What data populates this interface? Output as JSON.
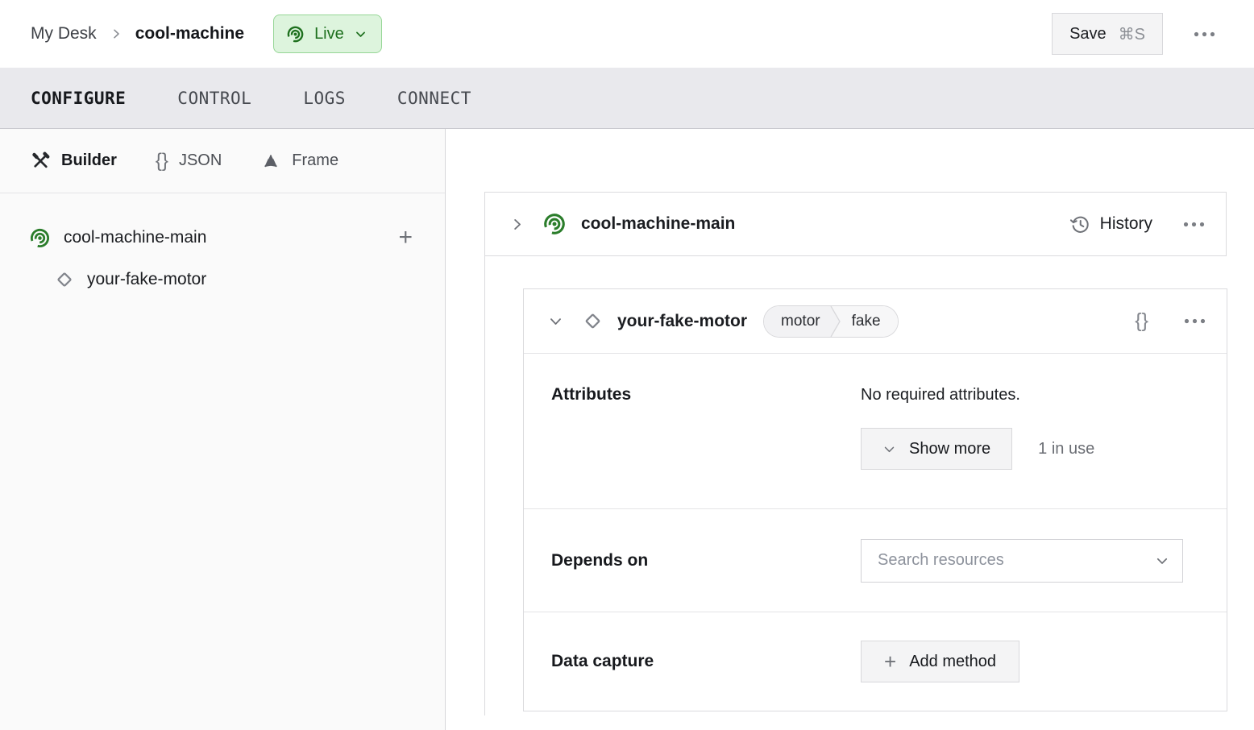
{
  "header": {
    "breadcrumb": {
      "root": "My Desk",
      "current": "cool-machine"
    },
    "live_badge": {
      "label": "Live"
    },
    "save_button": {
      "label": "Save",
      "shortcut": "⌘S"
    }
  },
  "nav_tabs": [
    {
      "label": "CONFIGURE"
    },
    {
      "label": "CONTROL"
    },
    {
      "label": "LOGS"
    },
    {
      "label": "CONNECT"
    }
  ],
  "sidebar": {
    "modes": [
      {
        "label": "Builder"
      },
      {
        "label": "JSON"
      },
      {
        "label": "Frame"
      }
    ],
    "tree": {
      "root_label": "cool-machine-main",
      "child_label": "your-fake-motor"
    }
  },
  "main": {
    "machine_card": {
      "title": "cool-machine-main",
      "history_label": "History"
    },
    "component_card": {
      "title": "your-fake-motor",
      "type_badge": {
        "type": "motor",
        "model": "fake"
      },
      "attributes": {
        "label": "Attributes",
        "empty_text": "No required attributes.",
        "show_more_label": "Show more",
        "usage_text": "1 in use"
      },
      "depends_on": {
        "label": "Depends on",
        "placeholder": "Search resources"
      },
      "data_capture": {
        "label": "Data capture",
        "add_button_label": "Add method"
      }
    }
  },
  "icons": {
    "braces": "{}",
    "plus": "+"
  },
  "colors": {
    "green": "#2b7d2b",
    "live_bg": "#ddf4dd",
    "live_border": "#96d696",
    "live_text": "#1e701e",
    "card_border": "#dbdbde",
    "button_bg": "#f4f4f5"
  }
}
